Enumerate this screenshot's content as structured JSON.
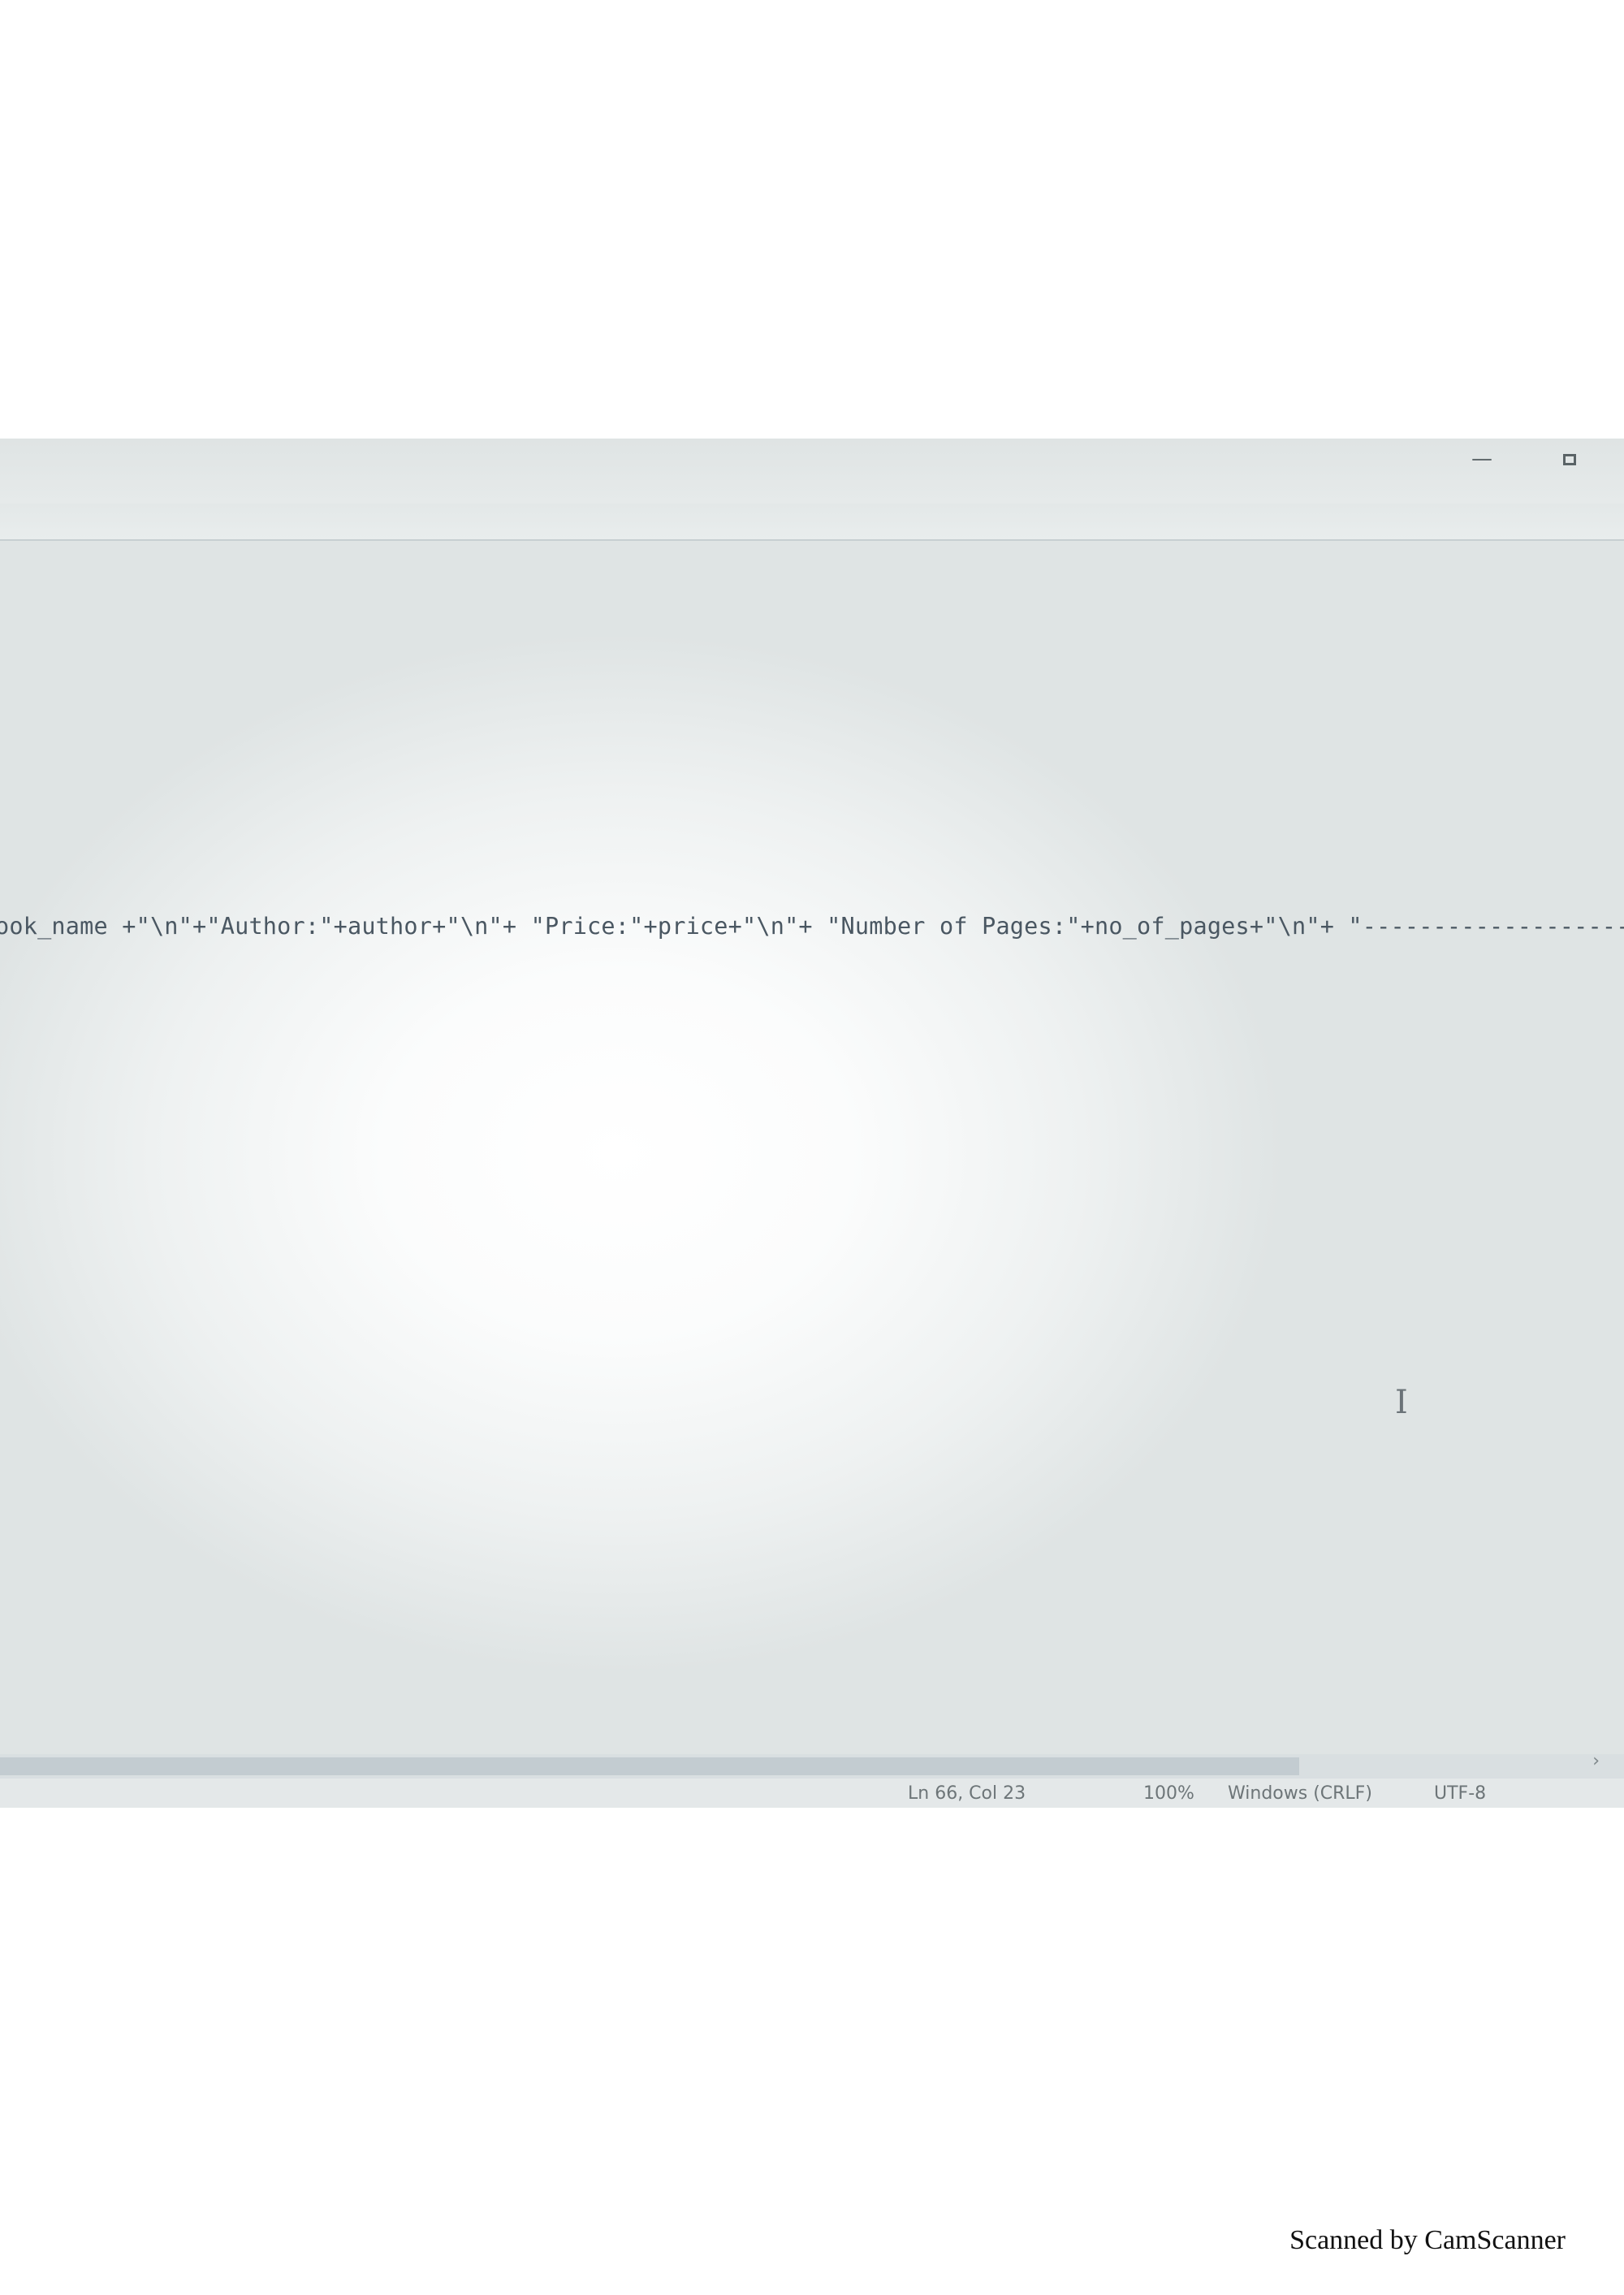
{
  "window": {
    "minimize_glyph": "—",
    "icons": [
      "minimize-icon",
      "maximize-icon",
      "text-cursor-icon",
      "scroll-right-arrow-icon"
    ]
  },
  "editor": {
    "code_line": "ook_name +\"\\n\"+\"Author:\"+author+\"\\n\"+ \"Price:\"+price+\"\\n\"+ \"Number of Pages:\"+no_of_pages+\"\\n\"+ \"------------------------------",
    "text_color": "#4a5762"
  },
  "statusbar": {
    "position": "Ln 66, Col 23",
    "zoom": "100%",
    "line_ending": "Windows (CRLF)",
    "encoding": "UTF-8"
  },
  "footer": {
    "watermark": "Scanned by CamScanner"
  }
}
